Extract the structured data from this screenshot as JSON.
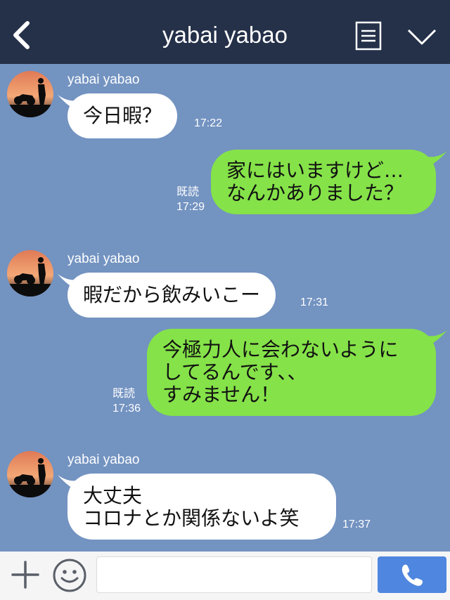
{
  "header": {
    "title": "yabai yabao",
    "back_icon": "chevron-left-icon",
    "memo_icon": "memo-icon",
    "menu_icon": "chevron-down-icon",
    "background": "#253149"
  },
  "chat": {
    "background": "#7393c1",
    "messages": [
      {
        "direction": "in",
        "sender": "yabai yabao",
        "text": "今日暇？",
        "time": "17:22"
      },
      {
        "direction": "out",
        "read": "既読",
        "text": "家にはいますけど…\nなんかありました？",
        "time": "17:29"
      },
      {
        "direction": "in",
        "sender": "yabai yabao",
        "text": "暇だから飲みいこー",
        "time": "17:31"
      },
      {
        "direction": "out",
        "read": "既読",
        "text": "今極力人に会わないように\nしてるんです、、\nすみません！",
        "time": "17:36"
      },
      {
        "direction": "in",
        "sender": "yabai yabao",
        "text": "大丈夫\nコロナとか関係ないよ笑",
        "time": "17:37"
      }
    ]
  },
  "footer": {
    "plus_icon": "plus-icon",
    "emoji_icon": "smiley-icon",
    "input_value": "",
    "call_icon": "phone-icon",
    "accent": "#4f86df"
  },
  "colors": {
    "incoming_bubble": "#ffffff",
    "outgoing_bubble": "#85e249"
  }
}
